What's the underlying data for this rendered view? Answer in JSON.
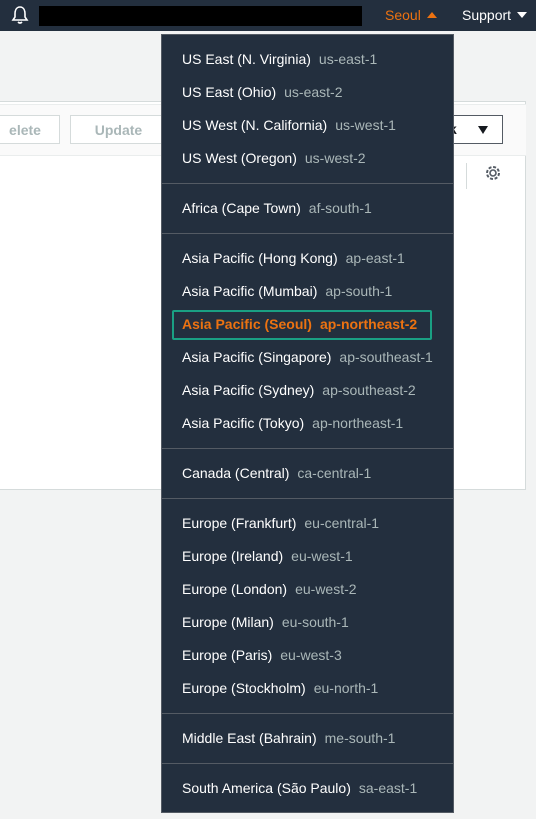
{
  "topbar": {
    "region_label": "Seoul",
    "support_label": "Support"
  },
  "panel": {
    "delete_label": "elete",
    "update_label": "Update",
    "action_label": "k"
  },
  "regions": {
    "groups": [
      [
        {
          "name": "US East (N. Virginia)",
          "code": "us-east-1"
        },
        {
          "name": "US East (Ohio)",
          "code": "us-east-2"
        },
        {
          "name": "US West (N. California)",
          "code": "us-west-1"
        },
        {
          "name": "US West (Oregon)",
          "code": "us-west-2"
        }
      ],
      [
        {
          "name": "Africa (Cape Town)",
          "code": "af-south-1"
        }
      ],
      [
        {
          "name": "Asia Pacific (Hong Kong)",
          "code": "ap-east-1"
        },
        {
          "name": "Asia Pacific (Mumbai)",
          "code": "ap-south-1"
        },
        {
          "name": "Asia Pacific (Seoul)",
          "code": "ap-northeast-2"
        },
        {
          "name": "Asia Pacific (Singapore)",
          "code": "ap-southeast-1"
        },
        {
          "name": "Asia Pacific (Sydney)",
          "code": "ap-southeast-2"
        },
        {
          "name": "Asia Pacific (Tokyo)",
          "code": "ap-northeast-1"
        }
      ],
      [
        {
          "name": "Canada (Central)",
          "code": "ca-central-1"
        }
      ],
      [
        {
          "name": "Europe (Frankfurt)",
          "code": "eu-central-1"
        },
        {
          "name": "Europe (Ireland)",
          "code": "eu-west-1"
        },
        {
          "name": "Europe (London)",
          "code": "eu-west-2"
        },
        {
          "name": "Europe (Milan)",
          "code": "eu-south-1"
        },
        {
          "name": "Europe (Paris)",
          "code": "eu-west-3"
        },
        {
          "name": "Europe (Stockholm)",
          "code": "eu-north-1"
        }
      ],
      [
        {
          "name": "Middle East (Bahrain)",
          "code": "me-south-1"
        }
      ],
      [
        {
          "name": "South America (São Paulo)",
          "code": "sa-east-1"
        }
      ]
    ],
    "selected_code": "ap-northeast-2"
  },
  "colors": {
    "nav_bg": "#232f3e",
    "accent": "#ec7211",
    "highlight_border": "#1aa083"
  }
}
